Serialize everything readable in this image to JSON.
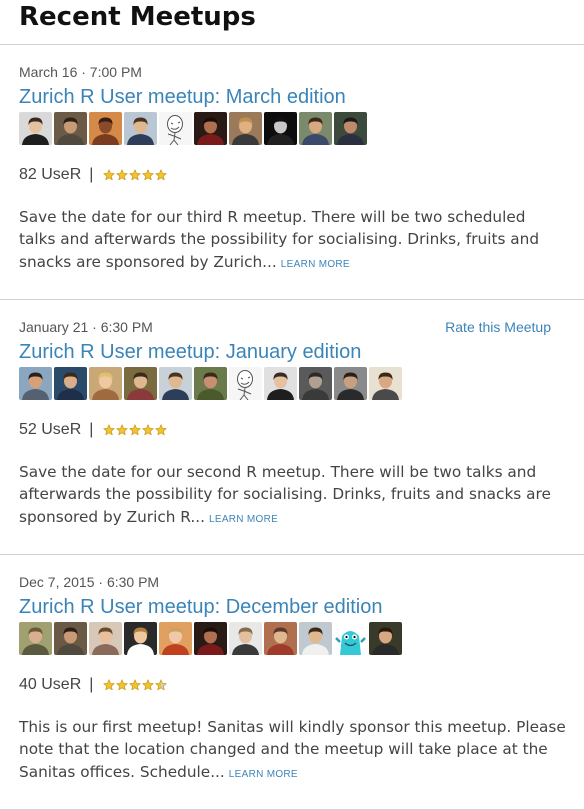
{
  "section_title": "Recent Meetups",
  "colors": {
    "link": "#3a84b8",
    "star_fill": "#f1c232",
    "star_stroke": "#c79a12",
    "star_empty": "#cfcfcf"
  },
  "meetups": [
    {
      "date": "March 16 · 7:00 PM",
      "title": "Zurich R User meetup: March edition",
      "rate_label": "",
      "rsvp": "82 UseR",
      "separator": "|",
      "rating": 5,
      "description": "Save the date for our third R meetup. There will be two scheduled talks and afterwards the possibility for socialising. Drinks, fruits and snacks are sponsored by Zurich...",
      "learn_more": "LEARN MORE",
      "avatars": [
        {
          "bg": "#d9d9d9",
          "face": "#e6c1a0",
          "hair": "#3a2a22",
          "shirt": "#1e1e1e"
        },
        {
          "bg": "#6b5a45",
          "face": "#c89a75",
          "hair": "#2c2018",
          "shirt": "#4f4a3d"
        },
        {
          "bg": "#d58a4a",
          "face": "#8b4a2a",
          "hair": "#3a1d10",
          "shirt": "#7a3c20"
        },
        {
          "bg": "#b8c7d3",
          "face": "#e0b890",
          "hair": "#4b3222",
          "shirt": "#2d3f58"
        },
        {
          "bg": "#f6f6f6",
          "face": "#ffffff",
          "hair": "#555555",
          "shirt": "#ffffff",
          "sketch": true
        },
        {
          "bg": "#2a1a16",
          "face": "#b07050",
          "hair": "#1a0e0a",
          "shirt": "#7a1a1a"
        },
        {
          "bg": "#9a7a5a",
          "face": "#e0b080",
          "hair": "#c09050",
          "shirt": "#3a3a3a"
        },
        {
          "bg": "#0d0d0d",
          "face": "#c8c8c8",
          "hair": "#101010",
          "shirt": "#202020"
        },
        {
          "bg": "#7b8a6a",
          "face": "#d8a882",
          "hair": "#3a2a1a",
          "shirt": "#3b4a6b"
        },
        {
          "bg": "#3b4a3a",
          "face": "#c08a6a",
          "hair": "#1a1a1a",
          "shirt": "#2b3040"
        }
      ]
    },
    {
      "date": "January 21 · 6:30 PM",
      "title": "Zurich R User meetup: January edition",
      "rate_label": "Rate this Meetup",
      "rsvp": "52 UseR",
      "separator": "|",
      "rating": 5,
      "description": "Save the date for our second R meetup. There will be two talks and afterwards the possibility for socialising. Drinks, fruits and snacks are sponsored by Zurich R...",
      "learn_more": "LEARN MORE",
      "avatars": [
        {
          "bg": "#8aa6c0",
          "face": "#d8a078",
          "hair": "#2c2018",
          "shirt": "#556070"
        },
        {
          "bg": "#2a4a6a",
          "face": "#d9ae88",
          "hair": "#3a2a1a",
          "shirt": "#1f2f4a"
        },
        {
          "bg": "#c9a878",
          "face": "#f0c8a0",
          "hair": "#e0c070",
          "shirt": "#a06a40"
        },
        {
          "bg": "#7a6a40",
          "face": "#e0b890",
          "hair": "#3a2a1a",
          "shirt": "#8a3a3a"
        },
        {
          "bg": "#c8d0d8",
          "face": "#e0b890",
          "hair": "#4b3222",
          "shirt": "#2d3f58"
        },
        {
          "bg": "#6a7a4a",
          "face": "#c89070",
          "hair": "#3a2a1a",
          "shirt": "#4a5a2a"
        },
        {
          "bg": "#f6f6f6",
          "face": "#ffffff",
          "hair": "#555555",
          "shirt": "#ffffff",
          "sketch": true
        },
        {
          "bg": "#e0e0e0",
          "face": "#e6c1a0",
          "hair": "#3a2a22",
          "shirt": "#1e1e1e"
        },
        {
          "bg": "#5a5a5a",
          "face": "#b0a090",
          "hair": "#2a2a2a",
          "shirt": "#3a3a3a"
        },
        {
          "bg": "#8a8a8a",
          "face": "#c8a080",
          "hair": "#2a2018",
          "shirt": "#2a2a2a"
        },
        {
          "bg": "#e8e0d0",
          "face": "#d8a882",
          "hair": "#3a2a1a",
          "shirt": "#4a4a4a"
        }
      ]
    },
    {
      "date": "Dec 7, 2015 · 6:30 PM",
      "title": "Zurich R User meetup: December edition",
      "rate_label": "",
      "rsvp": "40 UseR",
      "separator": "|",
      "rating": 4.5,
      "description": "This is our first meetup! Sanitas will kindly sponsor this meetup. Please note that the location changed and the meetup will take place at the Sanitas offices. Schedule...",
      "learn_more": "LEARN MORE",
      "avatars": [
        {
          "bg": "#a0a070",
          "face": "#d8b090",
          "hair": "#6a5a3a",
          "shirt": "#5a5a40"
        },
        {
          "bg": "#6a5a45",
          "face": "#c89a75",
          "hair": "#2c2018",
          "shirt": "#4f4a3d"
        },
        {
          "bg": "#d8c8b8",
          "face": "#e8c0a0",
          "hair": "#6a4a2a",
          "shirt": "#8a6a5a"
        },
        {
          "bg": "#2a2a2a",
          "face": "#f0c8a0",
          "hair": "#b08040",
          "shirt": "#ffffff"
        },
        {
          "bg": "#e0a060",
          "face": "#f0c8a8",
          "hair": "#d0a060",
          "shirt": "#c04020"
        },
        {
          "bg": "#2a1a16",
          "face": "#b07050",
          "hair": "#1a0e0a",
          "shirt": "#7a1a1a"
        },
        {
          "bg": "#e8e8e8",
          "face": "#e0c0a0",
          "hair": "#8a6a4a",
          "shirt": "#3a3a3a"
        },
        {
          "bg": "#b07050",
          "face": "#e0b890",
          "hair": "#5a3a2a",
          "shirt": "#a03a2a"
        },
        {
          "bg": "#c0c8d0",
          "face": "#e0b890",
          "hair": "#3a2a1a",
          "shirt": "#f0f0f0"
        },
        {
          "bg": "#ffffff",
          "face": "#35c9d8",
          "hair": "#2aa0b0",
          "shirt": "#35c9d8",
          "monster": true
        },
        {
          "bg": "#3a3a2a",
          "face": "#d8a882",
          "hair": "#2a1a0a",
          "shirt": "#2a2a2a"
        }
      ]
    }
  ]
}
